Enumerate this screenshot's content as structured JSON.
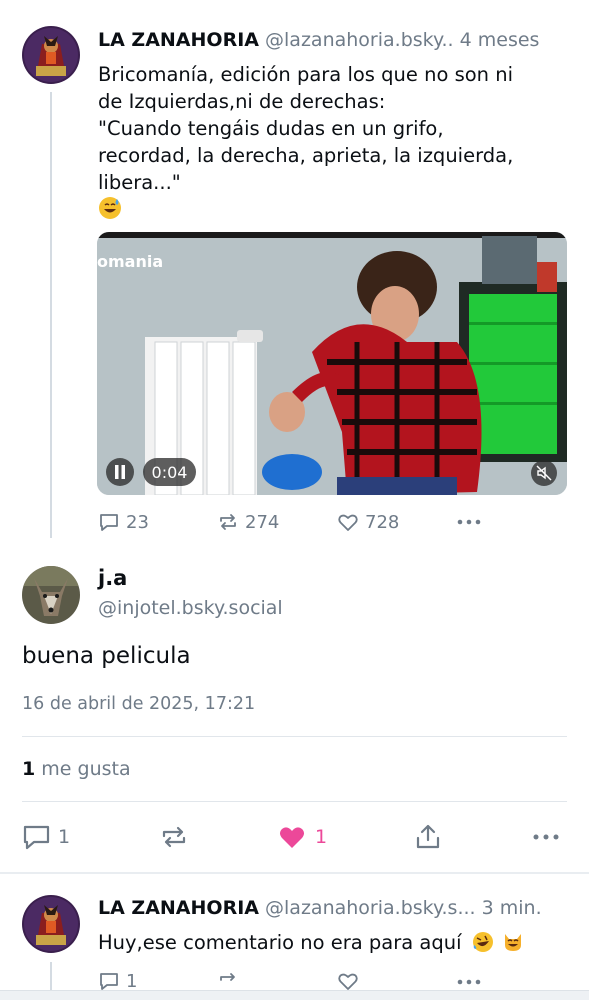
{
  "post1": {
    "display_name": "LA ZANAHORIA",
    "handle": "@lazanahoria.bsky..",
    "time_ago": "4 meses",
    "text": "Bricomanía, edición para los que no son ni\nde Izquierdas,ni de derechas:\n\"Cuando tengáis dudas en un grifo,\nrecordad, la derecha, aprieta, la izquierda,\nlibera...\"",
    "video": {
      "overlay_logo": "omania",
      "time": "0:04"
    },
    "reply_count": "23",
    "repost_count": "274",
    "like_count": "728"
  },
  "focus_post": {
    "display_name": "j.a",
    "handle": "@injotel.bsky.social",
    "text": "buena pelicula",
    "date": "16 de abril de 2025, 17:21",
    "likes_number": "1",
    "likes_label": "me gusta",
    "reply_count": "1",
    "like_count": "1",
    "like_color": "#ec4899"
  },
  "post3": {
    "display_name": "LA ZANAHORIA",
    "handle": "@lazanahoria.bsky.s...",
    "time_ago": "3 min.",
    "text": "Huy,ese comentario no era para aquí",
    "reply_count": "1"
  },
  "colors": {
    "muted": "#6f7b88",
    "thread_line": "#d4dbe2",
    "like_pink": "#ec4899"
  }
}
